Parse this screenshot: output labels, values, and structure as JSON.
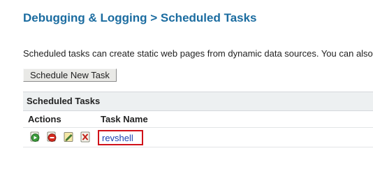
{
  "page": {
    "title": "Debugging & Logging > Scheduled Tasks",
    "description": "Scheduled tasks can create static web pages from dynamic data sources. You can also"
  },
  "toolbar": {
    "schedule_new_label": "Schedule New Task"
  },
  "panel": {
    "header": "Scheduled Tasks",
    "columns": {
      "actions": "Actions",
      "task_name": "Task Name"
    },
    "rows": [
      {
        "actions": [
          "run-icon",
          "delete-icon",
          "edit-icon",
          "log-icon"
        ],
        "task_name": "revshell"
      }
    ]
  },
  "colors": {
    "title": "#1b6ca0",
    "link": "#1a3fb0",
    "highlight_border": "#d0121a",
    "panel_header_bg": "#edf0f1"
  }
}
